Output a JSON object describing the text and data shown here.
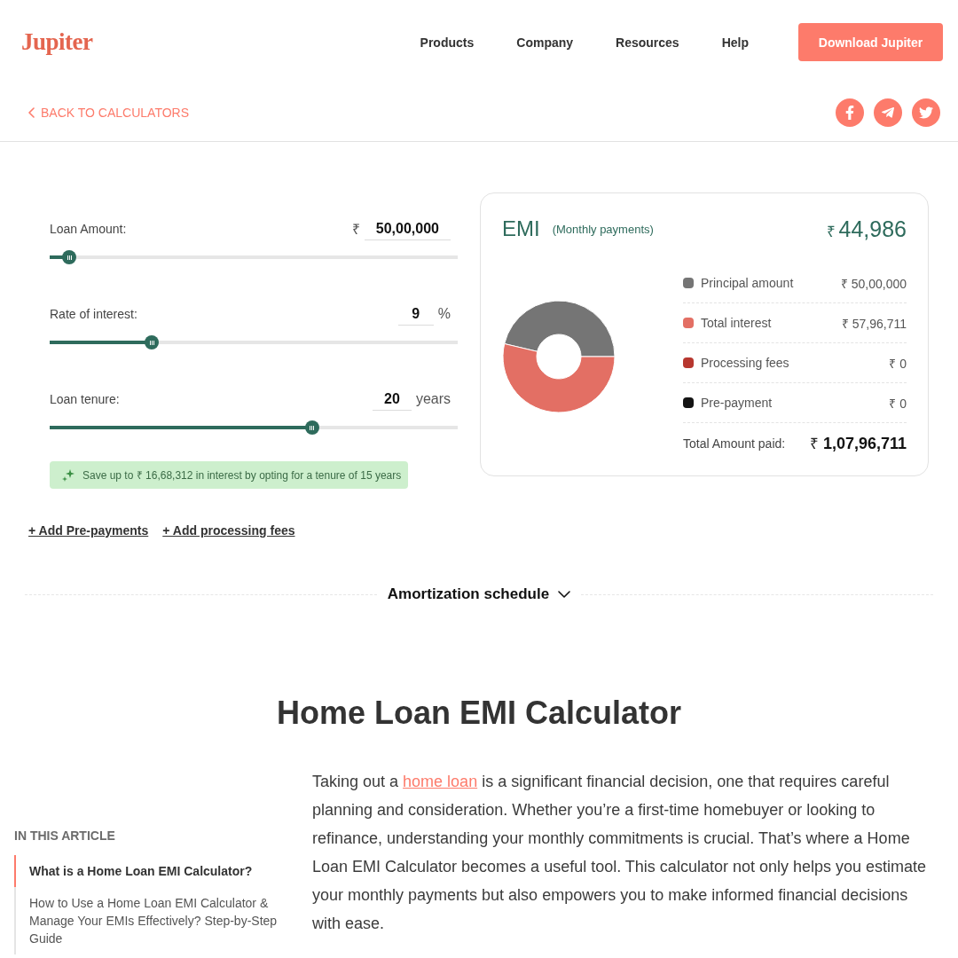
{
  "header": {
    "logo": "Jupiter",
    "nav": [
      {
        "label": "Products"
      },
      {
        "label": "Company"
      },
      {
        "label": "Resources"
      },
      {
        "label": "Help"
      }
    ],
    "cta": "Download Jupiter"
  },
  "subbar": {
    "back_link": "BACK TO CALCULATORS"
  },
  "calculator": {
    "inputs": [
      {
        "label": "Loan Amount:",
        "prefix": "₹",
        "value": "50,00,000",
        "level": 0.048
      },
      {
        "label": "Rate of interest:",
        "value": "9",
        "suffix": "%",
        "level": 0.25
      },
      {
        "label": "Loan tenure:",
        "value": "20",
        "suffix": "years",
        "level": 0.643
      }
    ],
    "tip": "Save up to ₹ 16,68,312 in interest by opting for a tenure of 15 years",
    "links": [
      "+ Add Pre-payments",
      "+ Add processing fees"
    ]
  },
  "summary": {
    "title": "EMI",
    "subtitle": "(Monthly payments)",
    "emi_currency": "₹",
    "emi": "44,986",
    "breakdown": [
      {
        "label": "Principal amount",
        "amount": "₹ 50,00,000",
        "color": "#757575"
      },
      {
        "label": "Total interest",
        "amount": "₹ 57,96,711",
        "color": "#e36f64"
      },
      {
        "label": "Processing fees",
        "amount": "₹ 0",
        "color": "#b7372f"
      },
      {
        "label": "Pre-payment",
        "amount": "₹ 0",
        "color": "#141414"
      }
    ],
    "total_label": "Total Amount paid:",
    "total_currency": "₹",
    "total": "1,07,96,711",
    "chart_data": {
      "type": "donut",
      "values": [
        46.31,
        53.69,
        0,
        0
      ]
    }
  },
  "amortization": {
    "label": "Amortization schedule",
    "expanded": false
  },
  "article": {
    "title": "Home Loan EMI Calculator",
    "toc_heading": "IN THIS ARTICLE",
    "toc": [
      {
        "label": "What is a Home Loan EMI Calculator?",
        "selected": true
      },
      {
        "label": "How to Use a Home Loan EMI Calculator & Manage Your EMIs Effectively? Step-by-Step Guide",
        "selected": false
      }
    ],
    "intro": [
      {
        "kind": "text",
        "text": "Taking out a "
      },
      {
        "kind": "link",
        "text": "home loan"
      },
      {
        "kind": "text",
        "text": " is a significant financial decision, one that requires careful planning and consideration. Whether you’re a first-time homebuyer or looking to refinance, understanding your monthly commitments is crucial. That’s where a Home Loan EMI Calculator becomes a useful tool. This calculator not only helps you estimate your monthly payments but also empowers you to make informed financial decisions with ease."
      }
    ]
  }
}
